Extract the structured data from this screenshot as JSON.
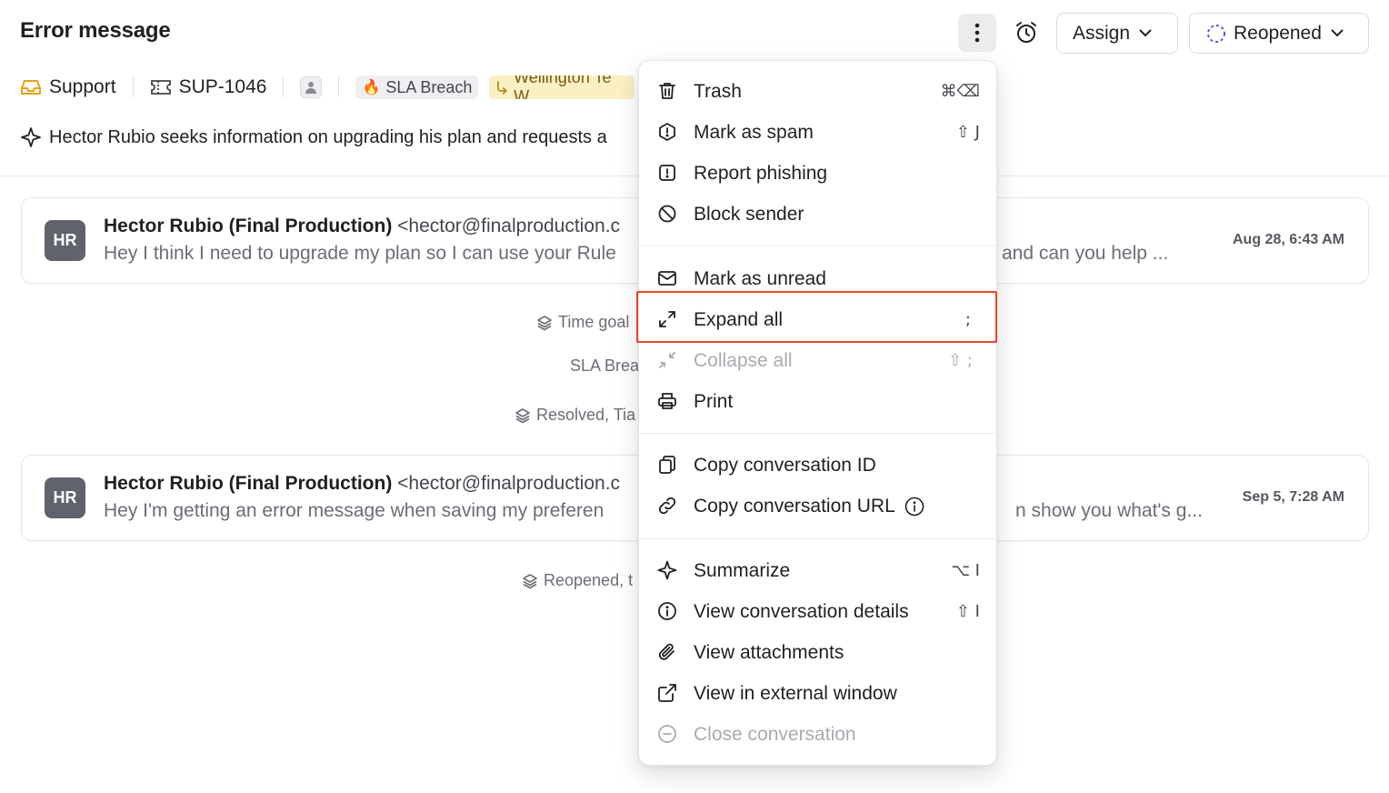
{
  "header": {
    "title": "Error message",
    "assign_label": "Assign",
    "status_label": "Reopened"
  },
  "meta": {
    "inbox": "Support",
    "ticket_id": "SUP-1046",
    "tag_sla": "SLA Breach",
    "tag_org": "Wellington Te W"
  },
  "summary": {
    "text": "Hector Rubio seeks information on upgrading his plan and requests a"
  },
  "messages": [
    {
      "avatar": "HR",
      "sender_name": "Hector Rubio (Final Production)",
      "sender_email": "<hector@finalproduction.c",
      "preview": "Hey I think I need to upgrade my plan so I can use your Rule",
      "preview_tail": "and can you help ...",
      "date": "Aug 28, 6:43 AM"
    },
    {
      "avatar": "HR",
      "sender_name": "Hector Rubio (Final Production)",
      "sender_email": "<hector@finalproduction.c",
      "preview": "Hey I'm getting an error message when saving my preferen",
      "preview_tail": "n show you what's g...",
      "date": "Sep 5, 7:28 AM"
    }
  ],
  "events": {
    "time_goal": "Time goal",
    "sla_breach": "SLA Brea",
    "resolved": "Resolved, Tia",
    "reopened": "Reopened, t"
  },
  "menu": {
    "items": [
      {
        "label": "Trash",
        "shortcut": "⌘⌫",
        "icon": "trash-icon"
      },
      {
        "label": "Mark as spam",
        "shortcut": "⇧ J",
        "icon": "spam-icon"
      },
      {
        "label": "Report phishing",
        "shortcut": "",
        "icon": "alert-icon"
      },
      {
        "label": "Block sender",
        "shortcut": "",
        "icon": "block-icon"
      },
      {
        "label": "Mark as unread",
        "shortcut": "",
        "icon": "mail-icon"
      },
      {
        "label": "Expand all",
        "shortcut": ";",
        "icon": "expand-icon"
      },
      {
        "label": "Collapse all",
        "shortcut": "⇧ ;",
        "icon": "collapse-icon"
      },
      {
        "label": "Print",
        "shortcut": "",
        "icon": "print-icon"
      },
      {
        "label": "Copy conversation ID",
        "shortcut": "",
        "icon": "copy-icon"
      },
      {
        "label": "Copy conversation URL",
        "shortcut": "",
        "icon": "link-icon"
      },
      {
        "label": "Summarize",
        "shortcut": "⌥ I",
        "icon": "sparkle-icon"
      },
      {
        "label": "View conversation details",
        "shortcut": "⇧ I",
        "icon": "info-icon"
      },
      {
        "label": "View attachments",
        "shortcut": "",
        "icon": "paperclip-icon"
      },
      {
        "label": "View in external window",
        "shortcut": "",
        "icon": "external-icon"
      },
      {
        "label": "Close conversation",
        "shortcut": "",
        "icon": "close-circle-icon"
      }
    ]
  },
  "colors": {
    "highlight": "#e4472b",
    "status_accent": "#5b5bd6",
    "inbox_accent": "#e8a317"
  }
}
